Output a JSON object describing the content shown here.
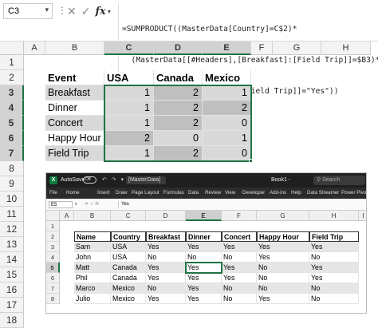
{
  "formula_bar": {
    "name_box": "C3",
    "formula_lines": [
      "=SUMPRODUCT((MasterData[Country]=C$2)*",
      "  (MasterData[[#Headers],[Breakfast]:[Field Trip]]=$B3)*",
      "  (MasterData[[Breakfast]:[Field Trip]]=\"Yes\"))"
    ]
  },
  "columns": [
    "A",
    "B",
    "C",
    "D",
    "E",
    "F",
    "G",
    "H"
  ],
  "rows": [
    "1",
    "2",
    "3",
    "4",
    "5",
    "6",
    "7",
    "8",
    "9",
    "10",
    "11",
    "12",
    "13",
    "14",
    "15",
    "16",
    "17",
    "18"
  ],
  "summary_table": {
    "headers": [
      "Event",
      "USA",
      "Canada",
      "Mexico"
    ],
    "rows": [
      {
        "event": "Breakfast",
        "values": [
          "1",
          "2",
          "1"
        ]
      },
      {
        "event": "Dinner",
        "values": [
          "1",
          "2",
          "2"
        ]
      },
      {
        "event": "Concert",
        "values": [
          "1",
          "2",
          "0"
        ]
      },
      {
        "event": "Happy Hour",
        "values": [
          "2",
          "0",
          "1"
        ]
      },
      {
        "event": "Field Trip",
        "values": [
          "1",
          "2",
          "0"
        ]
      }
    ]
  },
  "inner_window": {
    "logo": "X",
    "autosave_label": "AutoSave",
    "autosave_state": "Off",
    "quick_icons": "↶ ↷ ▾",
    "name_dropdown": "[MasterData]",
    "workbook": "Book1 -",
    "search_placeholder": "Search",
    "ribbon_tabs": [
      "File",
      "Home",
      "Insert",
      "Draw",
      "Page Layout",
      "Formulas",
      "Data",
      "Review",
      "View",
      "Developer",
      "Add-ins",
      "Help",
      "Data Streamer",
      "Power Pivot"
    ],
    "name_box": "E5",
    "fx_label": "fx",
    "cell_value": "Yes",
    "columns": [
      "A",
      "B",
      "C",
      "D",
      "E",
      "F",
      "G",
      "H",
      "I"
    ],
    "rows": [
      "1",
      "2",
      "3",
      "4",
      "5",
      "6",
      "7",
      "8"
    ],
    "table_headers": [
      "Name",
      "Country",
      "Breakfast",
      "Dinner",
      "Concert",
      "Happy Hour",
      "Field Trip"
    ],
    "table_rows": [
      [
        "Sam",
        "USA",
        "Yes",
        "Yes",
        "Yes",
        "Yes",
        "Yes"
      ],
      [
        "John",
        "USA",
        "No",
        "No",
        "No",
        "Yes",
        "No"
      ],
      [
        "Matt",
        "Canada",
        "Yes",
        "Yes",
        "Yes",
        "No",
        "Yes"
      ],
      [
        "Phil",
        "Canada",
        "Yes",
        "Yes",
        "Yes",
        "No",
        "Yes"
      ],
      [
        "Marco",
        "Mexico",
        "No",
        "Yes",
        "No",
        "No",
        "No"
      ],
      [
        "Julio",
        "Mexico",
        "Yes",
        "Yes",
        "No",
        "Yes",
        "No"
      ]
    ]
  }
}
